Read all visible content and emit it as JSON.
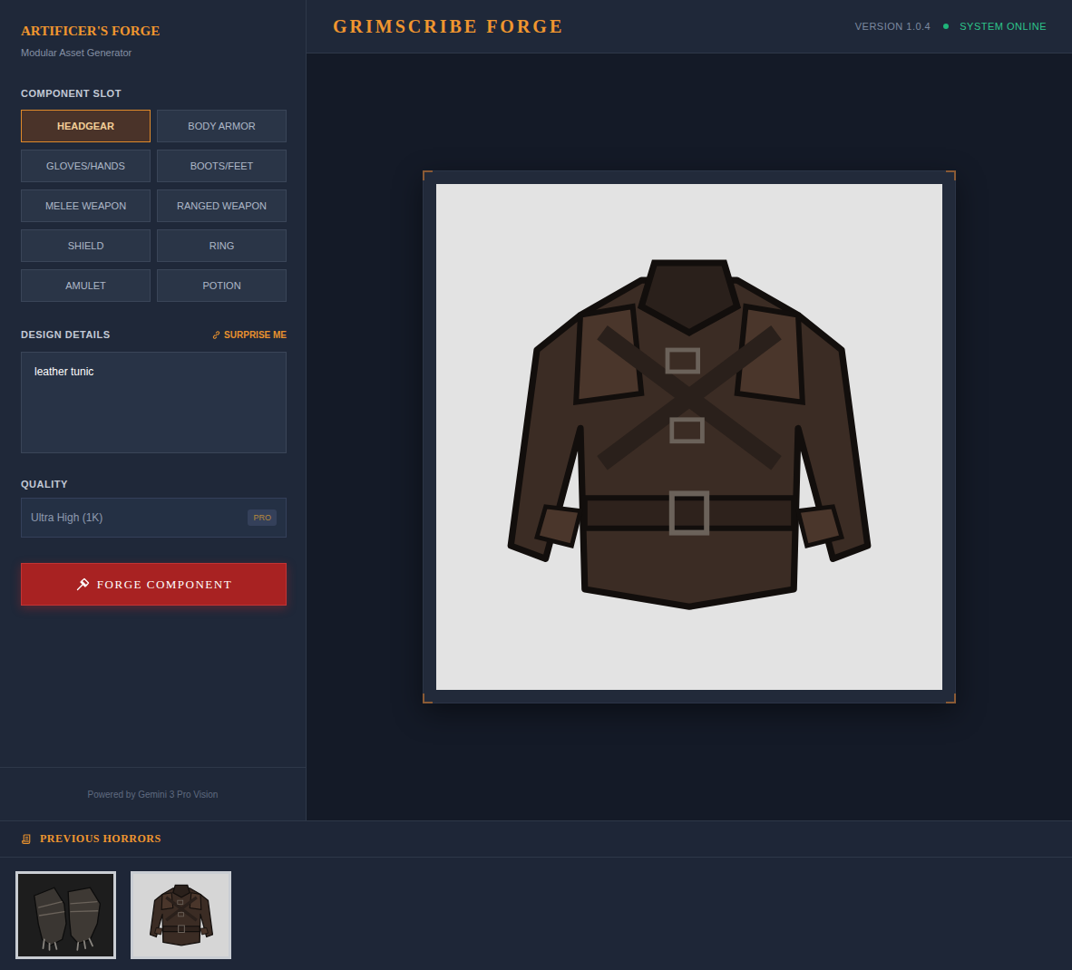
{
  "sidebar": {
    "title": "ARTIFICER'S FORGE",
    "subtitle": "Modular Asset Generator",
    "slot_label": "COMPONENT SLOT",
    "slots": [
      {
        "label": "HEADGEAR",
        "selected": true
      },
      {
        "label": "BODY ARMOR",
        "selected": false
      },
      {
        "label": "GLOVES/HANDS",
        "selected": false
      },
      {
        "label": "BOOTS/FEET",
        "selected": false
      },
      {
        "label": "MELEE WEAPON",
        "selected": false
      },
      {
        "label": "RANGED WEAPON",
        "selected": false
      },
      {
        "label": "SHIELD",
        "selected": false
      },
      {
        "label": "RING",
        "selected": false
      },
      {
        "label": "AMULET",
        "selected": false
      },
      {
        "label": "POTION",
        "selected": false
      }
    ],
    "details_label": "DESIGN DETAILS",
    "surprise_button": "SURPRISE ME",
    "design_details": "leather tunic",
    "quality_label": "QUALITY",
    "quality": {
      "value": "Ultra High (1K)",
      "badge": "PRO"
    },
    "forge_button": "FORGE COMPONENT",
    "footer": "Powered by Gemini 3 Pro Vision"
  },
  "header": {
    "title": "GRIMSCRIBE FORGE",
    "version": "VERSION 1.0.4",
    "status": "SYSTEM ONLINE"
  },
  "history": {
    "title": "PREVIOUS HORRORS",
    "items": [
      {
        "kind": "gloves"
      },
      {
        "kind": "tunic"
      }
    ]
  }
}
